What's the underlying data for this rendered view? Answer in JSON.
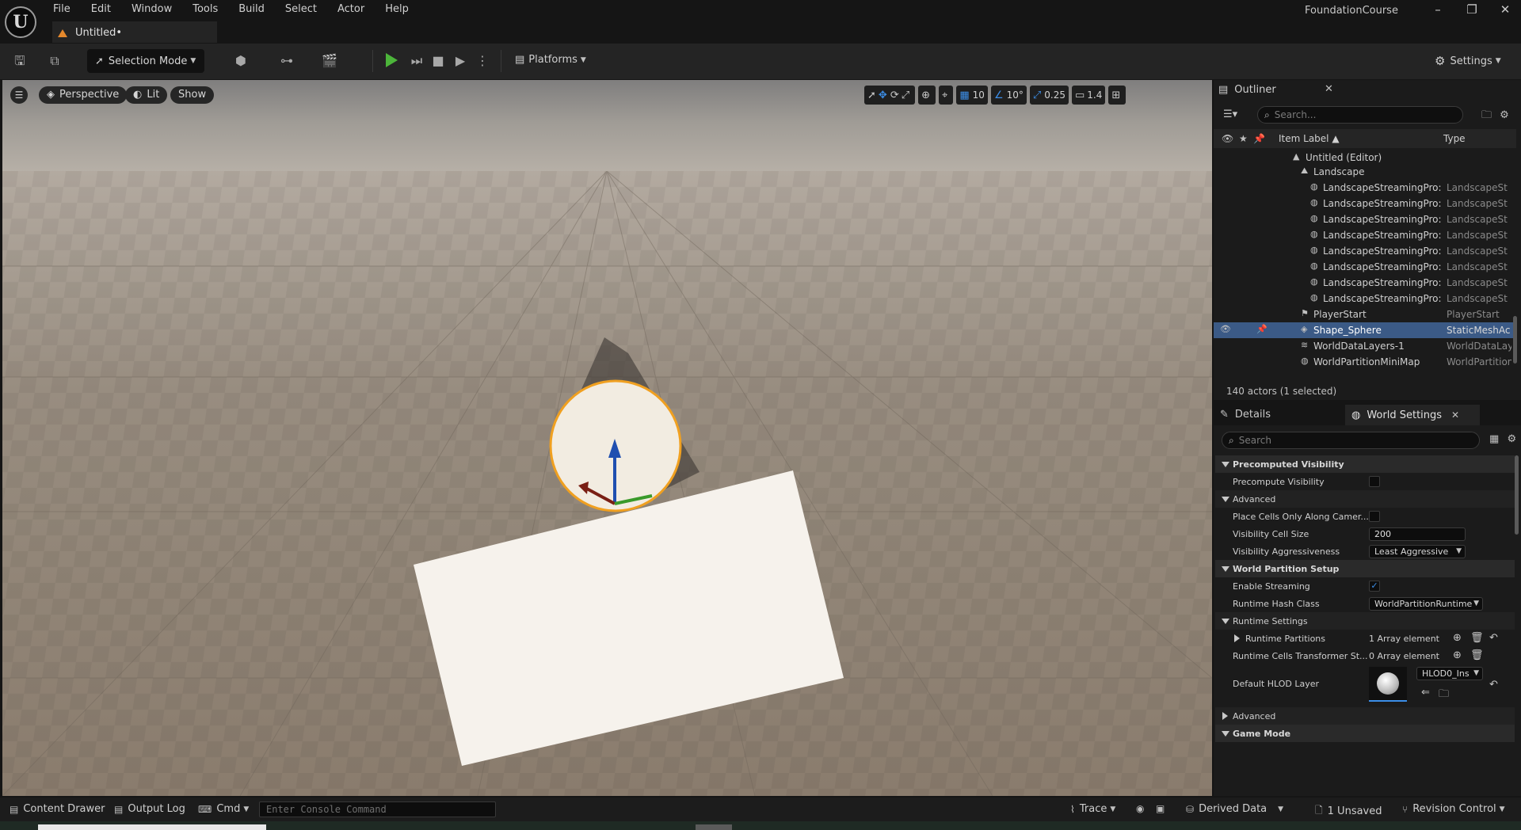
{
  "menu": {
    "items": [
      "File",
      "Edit",
      "Window",
      "Tools",
      "Build",
      "Select",
      "Actor",
      "Help"
    ]
  },
  "app": {
    "project_name": "FoundationCourse",
    "document_tab": "Untitled•"
  },
  "toolbar": {
    "selection_mode": "Selection Mode",
    "platforms": "Platforms",
    "settings": "Settings"
  },
  "viewport": {
    "perspective": "Perspective",
    "lit": "Lit",
    "show": "Show",
    "grid_snap": "10",
    "rotation_snap": "10°",
    "scale_snap": "0.25",
    "camera_speed": "1.4"
  },
  "outliner": {
    "title": "Outliner",
    "search_placeholder": "Search...",
    "col_label": "Item Label ▲",
    "col_type": "Type",
    "rows": [
      {
        "label": "Untitled (Editor)",
        "type": ""
      },
      {
        "label": "Landscape",
        "type": ""
      },
      {
        "label": "LandscapeStreamingPro:",
        "type": "LandscapeSt"
      },
      {
        "label": "LandscapeStreamingPro:",
        "type": "LandscapeSt"
      },
      {
        "label": "LandscapeStreamingPro:",
        "type": "LandscapeSt"
      },
      {
        "label": "LandscapeStreamingPro:",
        "type": "LandscapeSt"
      },
      {
        "label": "LandscapeStreamingPro:",
        "type": "LandscapeSt"
      },
      {
        "label": "LandscapeStreamingPro:",
        "type": "LandscapeSt"
      },
      {
        "label": "LandscapeStreamingPro:",
        "type": "LandscapeSt"
      },
      {
        "label": "LandscapeStreamingPro:",
        "type": "LandscapeSt"
      },
      {
        "label": "PlayerStart",
        "type": "PlayerStart"
      },
      {
        "label": "Shape_Sphere",
        "type": "StaticMeshAc"
      },
      {
        "label": "WorldDataLayers-1",
        "type": "WorldDataLay"
      },
      {
        "label": "WorldPartitionMiniMap",
        "type": "WorldPartition"
      }
    ],
    "footer": "140 actors (1 selected)"
  },
  "details": {
    "tab": "Details",
    "world_settings_tab": "World Settings",
    "search_placeholder": "Search",
    "rows": {
      "precomputed_visibility": "Precomputed Visibility",
      "precompute_visibility": "Precompute Visibility",
      "advanced": "Advanced",
      "place_cells": "Place Cells Only Along Camer...",
      "visibility_cell_size": "Visibility Cell Size",
      "visibility_cell_size_value": "200",
      "visibility_aggressiveness": "Visibility Aggressiveness",
      "visibility_aggressiveness_value": "Least Aggressive",
      "world_partition_setup": "World Partition Setup",
      "enable_streaming": "Enable Streaming",
      "runtime_hash_class": "Runtime Hash Class",
      "runtime_hash_class_value": "WorldPartitionRuntime",
      "runtime_settings": "Runtime Settings",
      "runtime_partitions": "Runtime Partitions",
      "runtime_partitions_value": "1 Array element",
      "runtime_cells_transformer": "Runtime Cells Transformer St...",
      "runtime_cells_transformer_value": "0 Array element",
      "default_hlod_layer": "Default HLOD Layer",
      "default_hlod_layer_value": "HLOD0_Ins",
      "advanced2": "Advanced",
      "game_mode": "Game Mode"
    }
  },
  "statusbar": {
    "content_drawer": "Content Drawer",
    "output_log": "Output Log",
    "cmd": "Cmd",
    "console_placeholder": "Enter Console Command",
    "trace": "Trace",
    "derived_data": "Derived Data",
    "unsaved": "1 Unsaved",
    "revision_control": "Revision Control"
  },
  "colors": {
    "accent_blue": "#3c8ee8",
    "play_green": "#4cb53a",
    "selection_row": "#3b5a86",
    "sphere_outline": "#f0a020"
  }
}
